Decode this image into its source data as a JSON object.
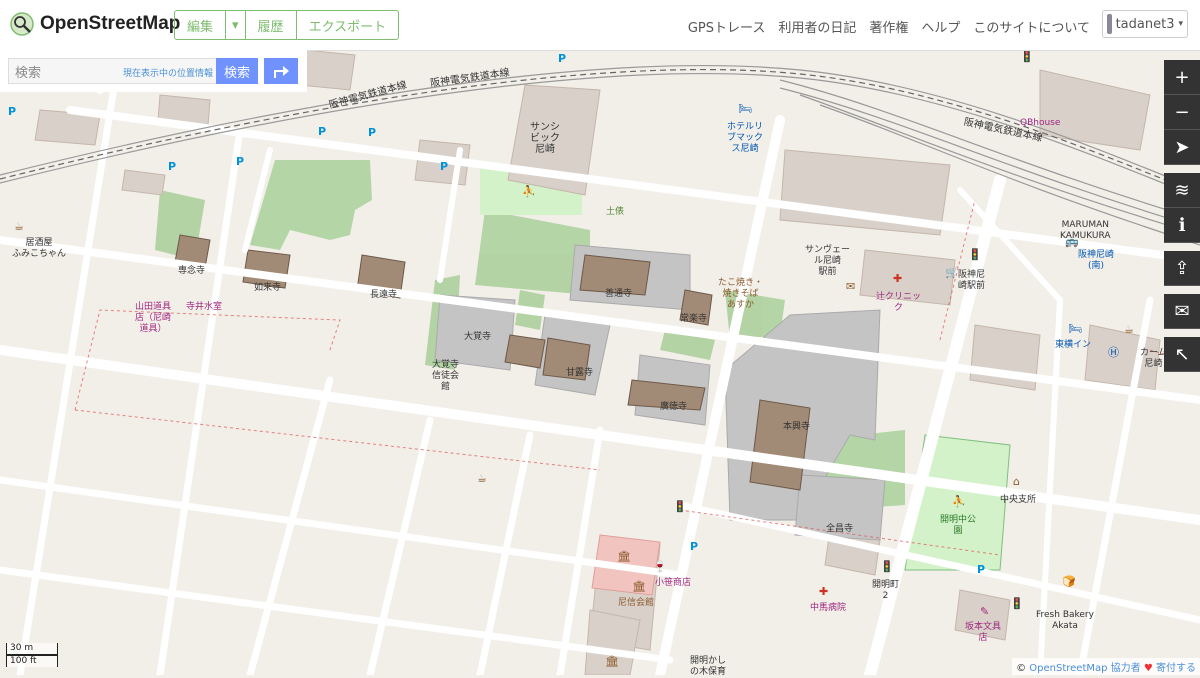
{
  "header": {
    "logo_text": "OpenStreetMap",
    "edit_label": "編集",
    "history_label": "履歴",
    "export_label": "エクスポート",
    "nav": [
      "GPSトレース",
      "利用者の日記",
      "著作権",
      "ヘルプ",
      "このサイトについて"
    ],
    "username": "tadanet3"
  },
  "search": {
    "placeholder": "検索",
    "here_link": "現在表示中の位置情報",
    "button": "検索"
  },
  "map": {
    "labels": {
      "sunshine": "サンシ\nビック\n尼崎",
      "hotel": "ホテルリ\nブマック\nス尼崎",
      "dobashi": "土俵",
      "sunvale": "サンヴェー\nル尼崎\n駅前",
      "tsuji": "辻クリニッ\nク",
      "hanshin_station": "阪神尼\n崎駅前",
      "hanshin_amagasaki": "阪神尼崎\n(南)",
      "toyoko": "東横イン",
      "karm": "カーム\n尼崎",
      "maruman": "MARUMAN\nKAMUKURA",
      "qb": "QBhouse",
      "rail1": "阪神電気鉄道本線",
      "rail2": "阪神電気鉄道本線",
      "rail3": "阪神電気鉄道本線",
      "izakaya": "居酒屋\nふみこちゃん",
      "juneiji": "専念寺",
      "nyoraiji": "如来寺",
      "chotsuji": "長遠寺",
      "yamada": "山田道具\n店（尼崎\n道具）",
      "terai": "寺井水室",
      "zentsuji": "善通寺",
      "takoyaki": "たこ焼き・\n焼きそば\nあすか",
      "jorakuji": "常楽寺",
      "daikakuji": "大覚寺",
      "daikakuji_hall": "大覚寺\n信徒会\n館",
      "kanroji": "甘露寺",
      "kotokuji": "廣徳寺",
      "honkoji": "本興寺",
      "zenshoji": "全昌寺",
      "kaimei_park": "開明中公\n園",
      "chuo": "中央支所",
      "kaimeicho": "開明町\n2",
      "fresh": "Fresh Bakery\nAkata",
      "sakamoto": "坂本文具\n店",
      "nakama": "中馬病院",
      "ozasa": "小笹商店",
      "amashin": "尼信会館",
      "kashi": "開明かし\nの木保育"
    }
  },
  "controls": {
    "zoom_in": "+",
    "zoom_out": "−"
  },
  "scale": {
    "metric": "30 m",
    "imperial": "100 ft"
  },
  "attribution": {
    "prefix": "© ",
    "osm": "OpenStreetMap",
    "contributors": "協力者",
    "heart": "♥",
    "donate": "寄付する"
  }
}
